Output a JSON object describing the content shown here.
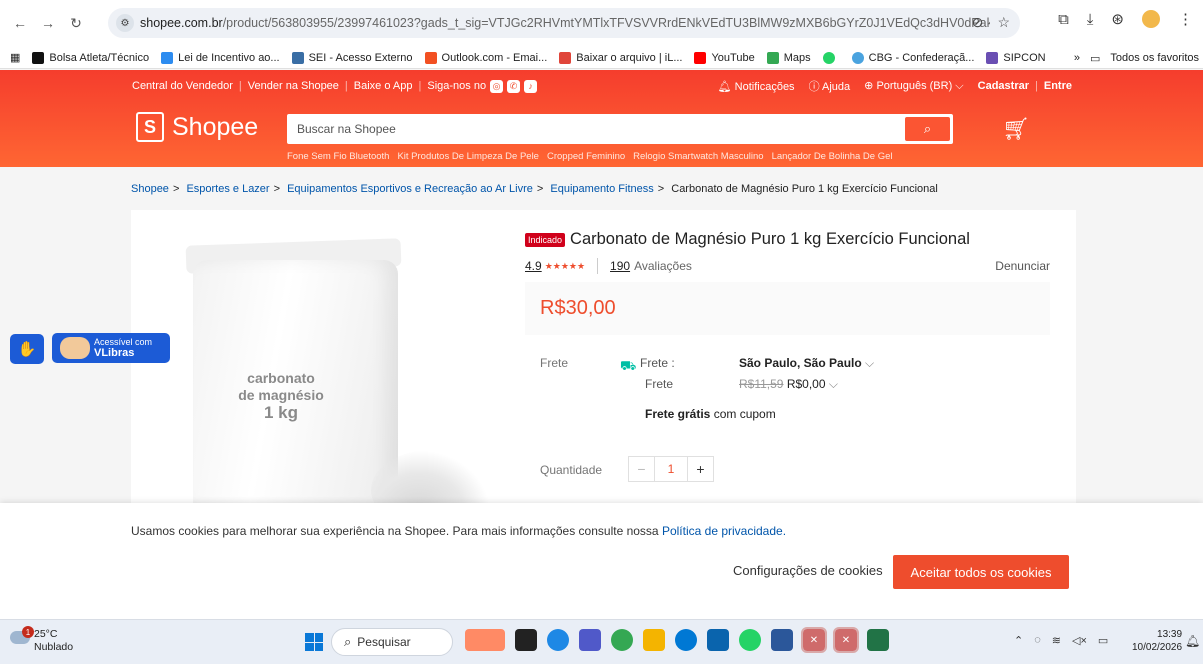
{
  "browser": {
    "url_host": "shopee.com.br",
    "url_path": "/product/563803955/23997461023?gads_t_sig=VTJGc2RHVmtYMTlxTFVSVVRrdENkVEdTU3BlMW9zMXB6bGYrZ0J1VEdQc3dHV0dPak9Zb0orVnFsZzBFSU94ODR0..."
  },
  "bookmarks": {
    "items": [
      {
        "label": "Bolsa Atleta/Técnico",
        "color": "#111111"
      },
      {
        "label": "Lei de Incentivo ao...",
        "color": "#2d8cf0"
      },
      {
        "label": "SEI - Acesso Externo",
        "color": "#3a6ea5"
      },
      {
        "label": "Outlook.com - Emai...",
        "color": "#f25022"
      },
      {
        "label": "Baixar o arquivo | iL...",
        "color": "#e0453a"
      },
      {
        "label": "YouTube",
        "color": "#ff0000"
      },
      {
        "label": "Maps",
        "color": "#34a853"
      },
      {
        "label": "",
        "color": "#25d366"
      },
      {
        "label": "CBG - Confederaçã...",
        "color": "#4aa3df"
      },
      {
        "label": "SIPCON",
        "color": "#6a4fb3"
      }
    ],
    "more": "»",
    "all_favorites": "Todos os favoritos"
  },
  "topnav": {
    "seller_center": "Central do Vendedor",
    "sell": "Vender na Shopee",
    "app": "Baixe o App",
    "follow": "Siga-nos no",
    "notifications": "Notificações",
    "help": "Ajuda",
    "language": "Português (BR)",
    "register": "Cadastrar",
    "login": "Entre"
  },
  "header": {
    "logo": "Shopee",
    "search_placeholder": "Buscar na Shopee",
    "suggestions": [
      "Fone Sem Fio Bluetooth",
      "Kit Produtos De Limpeza De Pele",
      "Cropped Feminino",
      "Relogio Smartwatch Masculino",
      "Lançador De Bolinha De Gel"
    ]
  },
  "breadcrumb": {
    "items": [
      "Shopee",
      "Esportes e Lazer",
      "Equipamentos Esportivos e Recreação ao Ar Livre",
      "Equipamento Fitness"
    ],
    "current": "Carbonato de Magnésio Puro 1 kg Exercício Funcional"
  },
  "product": {
    "image_text": [
      "carbonato",
      "de magnésio",
      "1 kg"
    ],
    "badge": "Indicado",
    "title": "Carbonato de Magnésio Puro 1 kg Exercício Funcional",
    "rating": "4.9",
    "rating_stars": 5,
    "review_count": "190",
    "review_label": "Avaliações",
    "report": "Denunciar",
    "price": "R$30,00",
    "shipping_label": "Frete",
    "shipping_to_label": "Frete :",
    "shipping_location": "São Paulo, São Paulo",
    "shipping_cost_label": "Frete",
    "shipping_old_price": "R$11,59",
    "shipping_new_price": "R$0,00",
    "free_shipping_bold": "Frete grátis",
    "free_shipping_rest": "com cupom",
    "quantity_label": "Quantidade",
    "quantity": "1"
  },
  "accessibility": {
    "line1": "Acessível com",
    "line2": "VLibras"
  },
  "cookie": {
    "text": "Usamos cookies para melhorar sua experiência na Shopee. Para mais informações consulte nossa",
    "link": "Política de privacidade.",
    "config": "Configurações de cookies",
    "accept": "Aceitar todos os cookies"
  },
  "taskbar": {
    "temperature": "25°C",
    "weather": "Nublado",
    "weather_alert": "1",
    "search": "Pesquisar",
    "time": "13:39",
    "date": "10/02/2026",
    "apps": [
      {
        "name": "widgets-app",
        "color": "#ff8a65"
      },
      {
        "name": "file-explorer-app",
        "color": "#222222"
      },
      {
        "name": "edge-app",
        "color": "#1e88e5"
      },
      {
        "name": "teams-app",
        "color": "#5059c9"
      },
      {
        "name": "chrome-app",
        "color": "#34a853"
      },
      {
        "name": "folder-app",
        "color": "#f4b400"
      },
      {
        "name": "store-app",
        "color": "#0078d4"
      },
      {
        "name": "outlook-app",
        "color": "#0a64ad"
      },
      {
        "name": "whatsapp-app",
        "color": "#25d366"
      },
      {
        "name": "word-app",
        "color": "#2b579a"
      },
      {
        "name": "xbox-app",
        "color": "#107c10"
      },
      {
        "name": "xbox-app-2",
        "color": "#107c10"
      },
      {
        "name": "excel-app",
        "color": "#217346"
      }
    ]
  }
}
